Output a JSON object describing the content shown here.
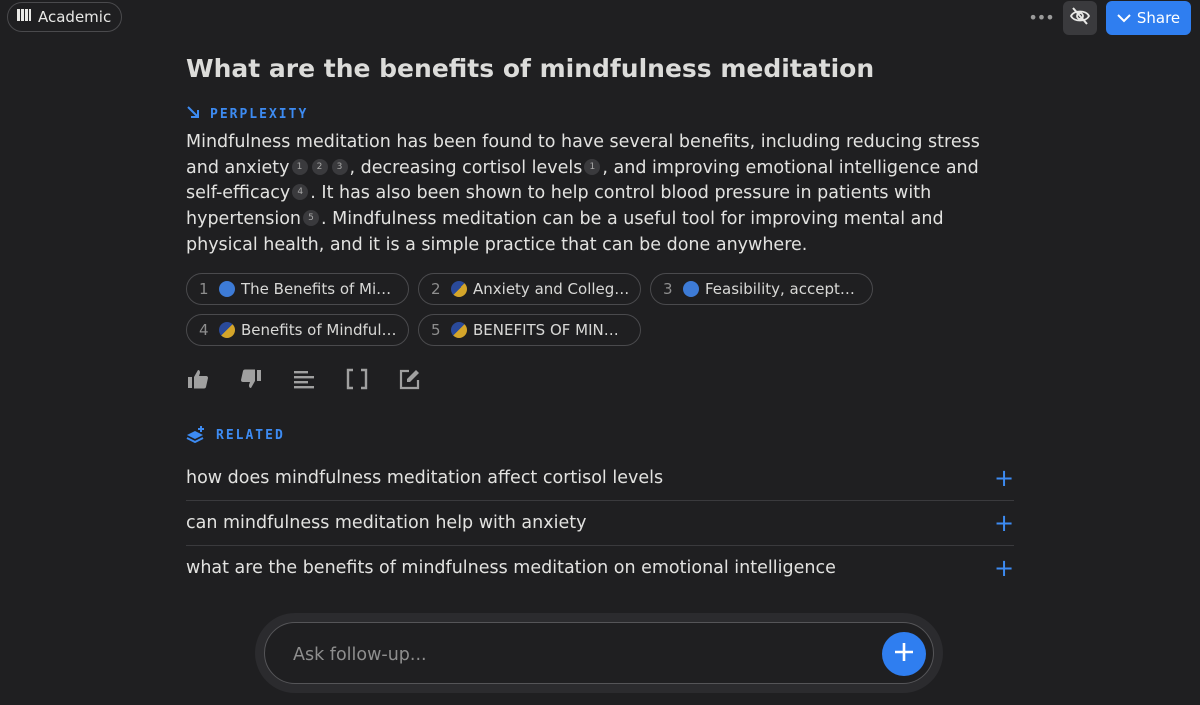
{
  "topbar": {
    "focus_mode": "Academic",
    "share_label": "Share"
  },
  "thread": {
    "title": "What are the benefits of mindfulness meditation",
    "answer_label": "PERPLEXITY",
    "answer_segments": [
      {
        "text": "Mindfulness meditation has been found to have several benefits, including reducing stress and anxiety"
      },
      {
        "cite": "1"
      },
      {
        "cite": "2"
      },
      {
        "cite": "3"
      },
      {
        "text": ", decreasing cortisol levels"
      },
      {
        "cite": "1"
      },
      {
        "text": ", and improving emotional intelligence and self-efficacy"
      },
      {
        "cite": "4"
      },
      {
        "text": ". It has also been shown to help control blood pressure in patients with hypertension"
      },
      {
        "cite": "5"
      },
      {
        "text": ". Mindfulness meditation can be a useful tool for improving mental and physical health, and it is a simple practice that can be done anywhere."
      }
    ],
    "sources": [
      {
        "num": "1",
        "label": "The Benefits of Mind…",
        "favicon": "blue-round"
      },
      {
        "num": "2",
        "label": "Anxiety and College…",
        "favicon": "wedge"
      },
      {
        "num": "3",
        "label": "Feasibility, accepta…",
        "favicon": "blue-round"
      },
      {
        "num": "4",
        "label": "Benefits of Mindfuln…",
        "favicon": "wedge"
      },
      {
        "num": "5",
        "label": "BENEFITS OF MINDFU…",
        "favicon": "wedge"
      }
    ],
    "actions": [
      "thumbs-up-icon",
      "thumbs-down-icon",
      "align-left-icon",
      "brackets-icon",
      "edit-icon"
    ]
  },
  "related": {
    "label": "RELATED",
    "items": [
      {
        "label": "how does mindfulness meditation affect cortisol levels"
      },
      {
        "label": "can mindfulness meditation help with anxiety"
      },
      {
        "label": "what are the benefits of mindfulness meditation on emotional intelligence"
      }
    ]
  },
  "followup": {
    "placeholder": "Ask follow-up..."
  },
  "colors": {
    "background": "#1f1f21",
    "accent": "#2f7ef0",
    "label_blue": "#3d8bf2"
  }
}
